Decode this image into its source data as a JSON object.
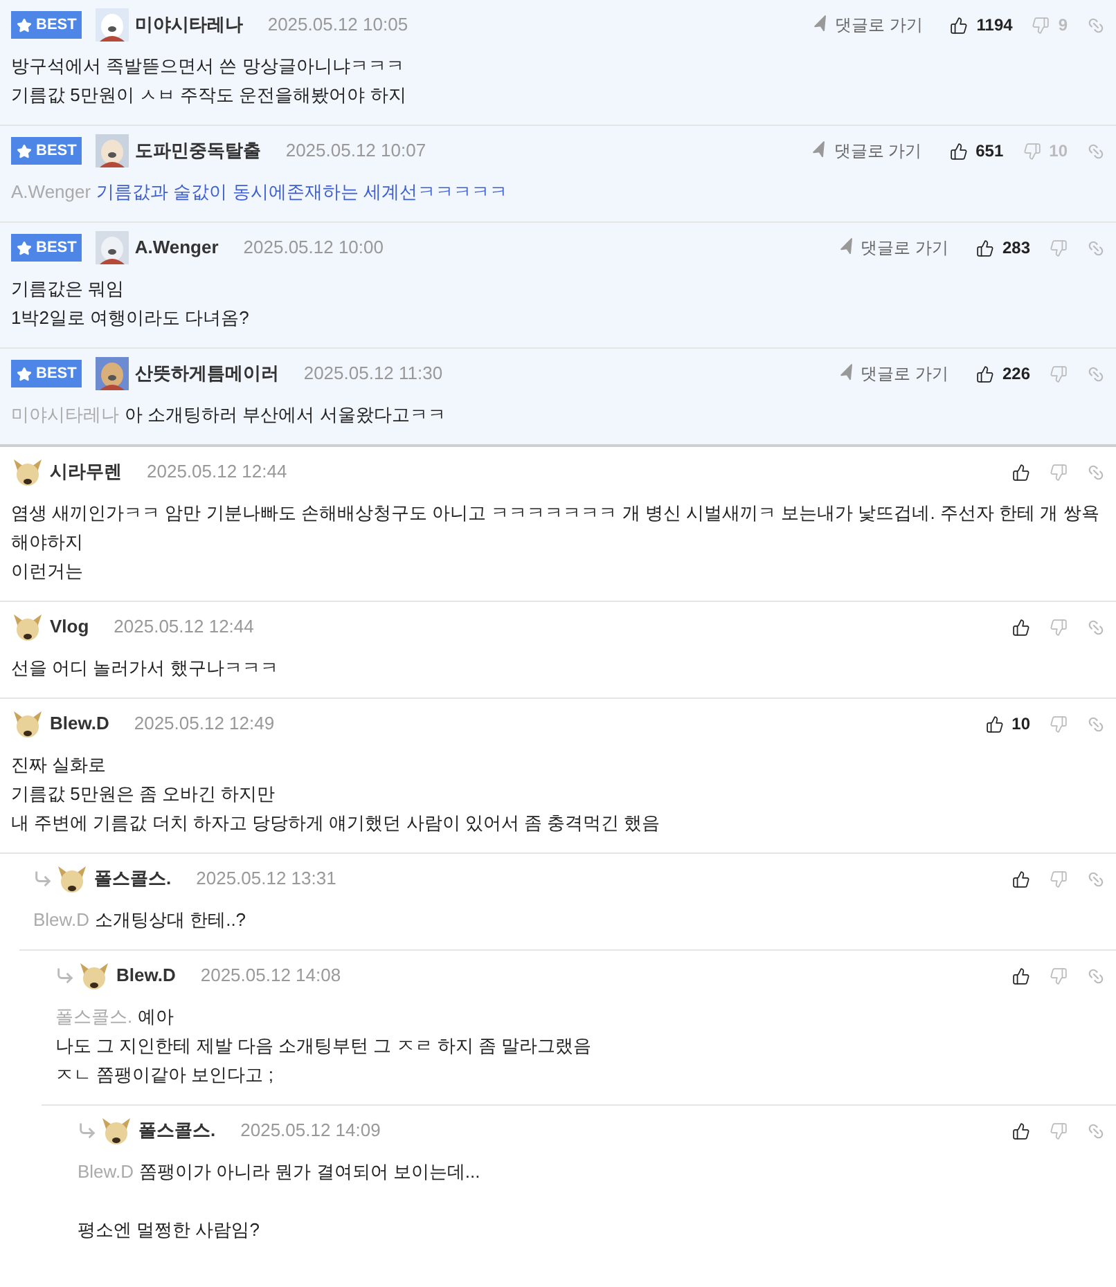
{
  "best_comments": [
    {
      "best_label": "BEST",
      "author": "미야시타레나",
      "time": "2025.05.12 10:05",
      "goto": "댓글로 가기",
      "likes": "1194",
      "dislikes": "9",
      "paragraphs": [
        [
          "방구석에서 족발뜯으면서 쓴 망상글아니냐ㅋㅋㅋ",
          "기름값 5만원이 ㅅㅂ 주작도 운전을해봤어야 하지"
        ]
      ]
    },
    {
      "best_label": "BEST",
      "author": "도파민중독탈출",
      "time": "2025.05.12 10:07",
      "goto": "댓글로 가기",
      "likes": "651",
      "dislikes": "10",
      "mention": "A.Wenger",
      "color": "#3d5fd1",
      "paragraphs": [
        [
          "기름값과 술값이 동시에존재하는 세계선ㅋㅋㅋㅋㅋ"
        ]
      ]
    },
    {
      "best_label": "BEST",
      "author": "A.Wenger",
      "time": "2025.05.12 10:00",
      "goto": "댓글로 가기",
      "likes": "283",
      "paragraphs": [
        [
          "기름값은 뭐임",
          "1박2일로 여행이라도 다녀옴?"
        ]
      ]
    },
    {
      "best_label": "BEST",
      "author": "산뜻하게틈메이러",
      "time": "2025.05.12 11:30",
      "goto": "댓글로 가기",
      "likes": "226",
      "mention": "미야시타레나",
      "paragraphs": [
        [
          "아 소개팅하러 부산에서 서울왔다고ㅋㅋ"
        ]
      ]
    }
  ],
  "comments": [
    {
      "author": "시라무렌",
      "time": "2025.05.12 12:44",
      "paragraphs": [
        [
          "염생 새끼인가ㅋㅋ 암만 기분나빠도 손해배상청구도 아니고 ㅋㅋㅋㅋㅋㅋㅋ 개 병신 시벌새끼ㅋ 보는내가 낯뜨겁네. 주선자 한테 개 쌍욕 해야하지",
          "이런거는"
        ]
      ]
    },
    {
      "author": "Vlog",
      "time": "2025.05.12 12:44",
      "paragraphs": [
        [
          "선을 어디 놀러가서 했구나ㅋㅋㅋ"
        ]
      ]
    },
    {
      "author": "Blew.D",
      "time": "2025.05.12 12:49",
      "likes": "10",
      "paragraphs": [
        [
          "진짜 실화로",
          "기름값 5만원은 좀 오바긴 하지만",
          "내 주변에 기름값 더치 하자고 당당하게 얘기했던 사람이 있어서 좀 충격먹긴 했음"
        ]
      ],
      "children": [
        {
          "author": "폴스콜스.",
          "time": "2025.05.12 13:31",
          "mention": "Blew.D",
          "paragraphs": [
            [
              "소개팅상대 한테..?"
            ]
          ],
          "children": [
            {
              "author": "Blew.D",
              "time": "2025.05.12 14:08",
              "mention": "폴스콜스.",
              "paragraphs": [
                [
                  "예아",
                  "나도 그 지인한테 제발 다음 소개팅부턴 그 ㅈㄹ 하지 좀 말라그랬음",
                  "ㅈㄴ 쫌팽이같아 보인다고 ;"
                ]
              ],
              "children": [
                {
                  "author": "폴스콜스.",
                  "time": "2025.05.12 14:09",
                  "mention": "Blew.D",
                  "paragraphs": [
                    [
                      "쫌팽이가 아니라 뭔가 결여되어 보이는데..."
                    ],
                    [
                      "평소엔 멀쩡한 사람임?"
                    ]
                  ]
                }
              ]
            }
          ]
        }
      ]
    }
  ]
}
